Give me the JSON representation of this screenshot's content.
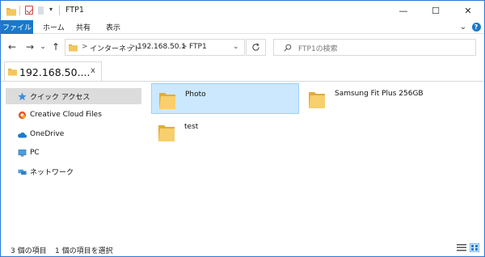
{
  "window": {
    "title": "FTP1",
    "controls": {
      "minimize": "—",
      "maximize": "☐",
      "close": "✕"
    }
  },
  "quick_access_toolbar": {
    "dropdown": "▾"
  },
  "ribbon": {
    "tabs": [
      {
        "label": "ファイル",
        "active": true
      },
      {
        "label": "ホーム"
      },
      {
        "label": "共有"
      },
      {
        "label": "表示"
      }
    ],
    "expand": "⌄",
    "help": "?"
  },
  "navigation": {
    "back": "←",
    "forward": "→",
    "recent": "⌄",
    "up": "↑"
  },
  "address_bar": {
    "segments": [
      "インターネット",
      "192.168.50.1",
      "FTP1"
    ],
    "separator": ">"
  },
  "search": {
    "placeholder": "FTP1の検索"
  },
  "doc_tab": {
    "title": "192.168.50....",
    "close": "x"
  },
  "nav_pane": {
    "items": [
      {
        "label": "クイック アクセス",
        "icon": "star-icon",
        "selected": true
      },
      {
        "label": "Creative Cloud Files",
        "icon": "creative-cloud-icon"
      },
      {
        "label": "OneDrive",
        "icon": "cloud-icon"
      },
      {
        "label": "PC",
        "icon": "computer-icon"
      },
      {
        "label": "ネットワーク",
        "icon": "network-icon"
      }
    ]
  },
  "content": {
    "items": [
      {
        "label": "Photo",
        "icon": "folder-icon",
        "selected": true
      },
      {
        "label": "Samsung Fit Plus 256GB",
        "icon": "folder-icon"
      },
      {
        "label": "test",
        "icon": "folder-icon"
      }
    ]
  },
  "status_bar": {
    "item_count": "3 個の項目",
    "selection": "1 個の項目を選択"
  },
  "colors": {
    "accent": "#1979ca",
    "selection_bg": "#cce8ff",
    "selection_border": "#99d1ff",
    "nav_selected": "#dcdcdc",
    "folder": "#f5c65a"
  }
}
